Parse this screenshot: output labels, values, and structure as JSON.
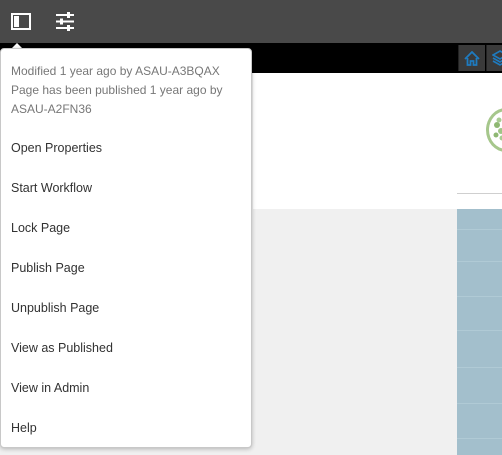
{
  "toolbar": {
    "buttons": [
      {
        "icon": "side-panel-icon"
      },
      {
        "icon": "properties-sliders-icon"
      }
    ]
  },
  "top_right": {
    "buttons": [
      {
        "icon": "home-icon"
      },
      {
        "icon": "layers-icon"
      }
    ]
  },
  "menu": {
    "meta": [
      "Modified 1 year ago by ASAU-A3BQAX",
      "Page has been published 1 year ago by",
      "ASAU-A2FN36"
    ],
    "items": [
      "Open Properties",
      "Start Workflow",
      "Lock Page",
      "Publish Page",
      "Unpublish Page",
      "View as Published",
      "View in Admin",
      "Help"
    ]
  },
  "colors": {
    "toolbar_bg": "#494949",
    "menu_text": "#323232",
    "meta_text": "#777777",
    "accent_blue": "#1e7bc0"
  }
}
